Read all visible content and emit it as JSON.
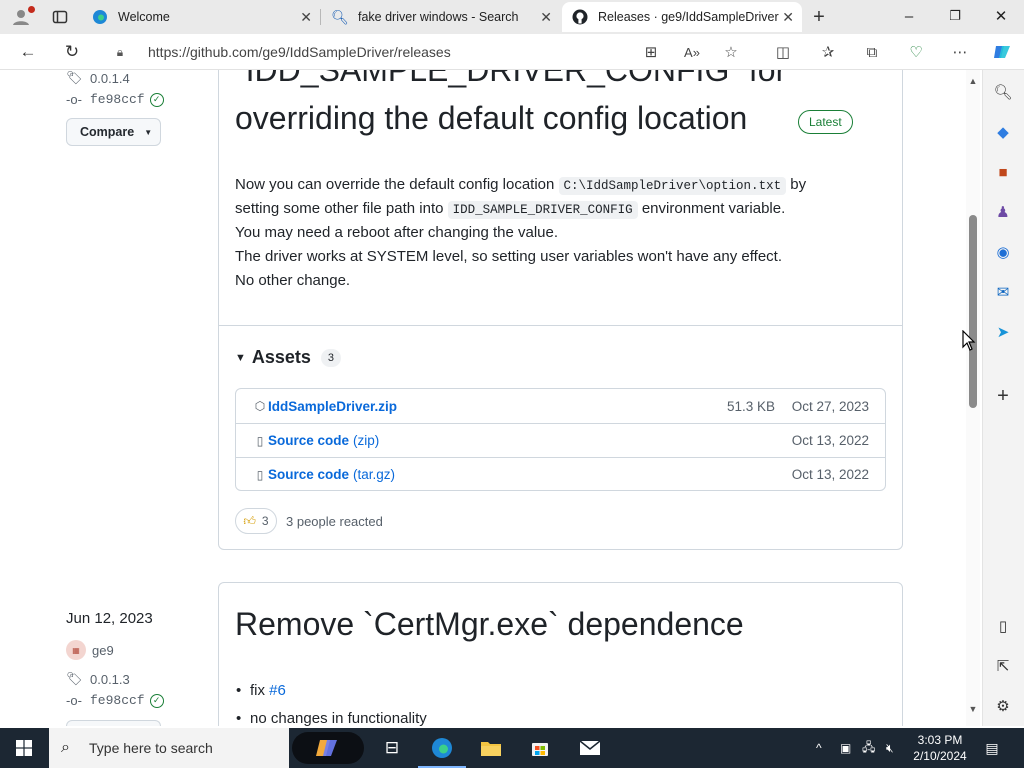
{
  "browser": {
    "tabs": [
      {
        "title": "Welcome",
        "active": false
      },
      {
        "title": "fake driver windows - Search",
        "active": false
      },
      {
        "title": "Releases · ge9/IddSampleDriver",
        "active": true
      }
    ],
    "url": "https://github.com/ge9/IddSampleDriver/releases",
    "icons": {
      "profile": "profile-icon",
      "workspaces": "workspaces-icon",
      "new_tab": "+",
      "minimize": "–",
      "maximize": "❐",
      "close": "✕"
    }
  },
  "release1": {
    "tag": "0.0.1.4",
    "commit": "fe98ccf",
    "compare_label": "Compare",
    "title_line1": "`IDD_SAMPLE_DRIVER_CONFIG` for",
    "title_line2": "overriding the default config location",
    "latest_label": "Latest",
    "body": {
      "l1_a": "Now you can override the default config location",
      "l1_code": "C:\\IddSampleDriver\\option.txt",
      "l1_b": "by",
      "l2_a": "setting some other file path into",
      "l2_code": "IDD_SAMPLE_DRIVER_CONFIG",
      "l2_b": "environment variable.",
      "l3": "You may need a reboot after changing the value.",
      "l4": "The driver works at SYSTEM level, so setting user variables won't have any effect.",
      "l5": "No other change."
    },
    "assets_label": "Assets",
    "assets_count": "3",
    "assets": [
      {
        "name": "IddSampleDriver.zip",
        "sub": "",
        "size": "51.3 KB",
        "date": "Oct 27, 2023"
      },
      {
        "name": "Source code",
        "sub": "(zip)",
        "size": "",
        "date": "Oct 13, 2022"
      },
      {
        "name": "Source code",
        "sub": "(tar.gz)",
        "size": "",
        "date": "Oct 13, 2022"
      }
    ],
    "reaction_count": "3",
    "reaction_text": "3 people reacted"
  },
  "release2": {
    "date": "Jun 12, 2023",
    "author": "ge9",
    "tag": "0.0.1.3",
    "commit": "fe98ccf",
    "title": "Remove `CertMgr.exe` dependence",
    "bullet1_text": "fix",
    "bullet1_link": "#6",
    "bullet2_text": "no changes in functionality"
  },
  "taskbar": {
    "search_placeholder": "Type here to search",
    "time": "3:03 PM",
    "date": "2/10/2024"
  },
  "colors": {
    "link": "#0969da",
    "latest": "#1a7f37",
    "taskbar": "#1c2733"
  }
}
